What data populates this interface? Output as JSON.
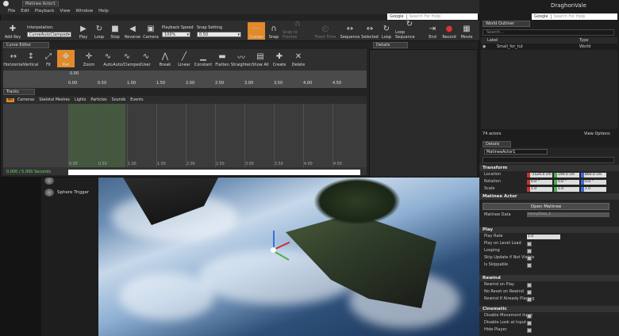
{
  "window": {
    "tab_title": "Matinee Actor1",
    "engine_title": "DraghonVale"
  },
  "menu": [
    "File",
    "Edit",
    "Playback",
    "View",
    "Window",
    "Help"
  ],
  "search": {
    "provider": "Google",
    "placeholder": "Search For Help"
  },
  "toolbar": {
    "add_key": "Add Key",
    "interpolation_label": "Interpolation:",
    "interpolation_value": "CurveAutoClamped",
    "play": "Play",
    "loop": "Loop",
    "stop": "Stop",
    "reverse": "Reverse",
    "camera": "Camera",
    "playback_speed_label": "Playback Speed",
    "playback_speed_value": "100%",
    "snap_setting_label": "Snap Setting",
    "snap_setting_value": "0.50",
    "curves": "Curves",
    "snap": "Snap",
    "snap_to_frames": "Snap to Frames",
    "fixed_time": "Fixed Time",
    "sequence": "Sequence",
    "selected": "Selected",
    "loop2": "Loop",
    "loop_sequence": "Loop Sequence",
    "end": "End",
    "record": "Record",
    "movie": "Movie"
  },
  "curve_editor": {
    "tab": "Curve Editor",
    "tools": [
      "Horizontal",
      "Vertical",
      "Fit",
      "Pan",
      "Zoom",
      "Auto",
      "Auto/Clamped",
      "User",
      "Break",
      "Linear",
      "Constant",
      "Flatten",
      "Straighten",
      "Show All",
      "Create",
      "Delete"
    ],
    "graph_top_label": "0.00",
    "ticks": [
      "0.00",
      "0.50",
      "1.00",
      "1.50",
      "2.00",
      "2.50",
      "3.00",
      "3.50",
      "4.00",
      "4.50"
    ]
  },
  "details_tab": "Details",
  "tracks": {
    "tab": "Tracks",
    "filters": [
      "All",
      "Cameras",
      "Skeletal Meshes",
      "Lights",
      "Particles",
      "Sounds",
      "Events"
    ],
    "ticks": [
      "0.00",
      "0.50",
      "1.00",
      "1.50",
      "2.00",
      "2.50",
      "3.00",
      "3.50",
      "4.00",
      "4.50"
    ],
    "time": "0.000 / 5.000 Seconds"
  },
  "place_items": [
    "Sphere Trigger"
  ],
  "world_outliner": {
    "tab": "World Outliner",
    "search_placeholder": "Search...",
    "col_label": "Label",
    "col_type": "Type",
    "row_label": "Small_for_tut",
    "row_type": "World",
    "actors": "74 actors",
    "view_options": "View Options"
  },
  "details": {
    "tab": "Details",
    "name": "MatineeActor1",
    "sections": {
      "transform": "Transform",
      "matinee_actor": "Matinee Actor",
      "play": "Play",
      "rewind": "Rewind",
      "cinematic": "Cinematic"
    },
    "location_label": "Location",
    "location": [
      "-1520.0 cm",
      "190.0 cm",
      "860.0 cm"
    ],
    "rotation_label": "Rotation",
    "rotation": [
      "0.0 °",
      "0.0 °",
      "0.0 °"
    ],
    "scale_label": "Scale",
    "scale": [
      "1.0",
      "1.0",
      "1.0"
    ],
    "open_matinee": "Open Matinee",
    "matinee_data_label": "Matinee Data",
    "matinee_data_value": "InterpData_1",
    "play_rate_label": "Play Rate",
    "play_rate_value": "1.0",
    "play_rows": [
      "Play on Level Load",
      "Looping",
      "Skip Update if Not Visible",
      "Is Skippable"
    ],
    "rewind_rows": [
      "Rewind on Play",
      "No Reset on Rewind",
      "Rewind If Already Playing"
    ],
    "cinematic_rows": [
      "Disable Movement Input",
      "Disable Look at Input",
      "Hide Player"
    ]
  },
  "colors": {
    "accent": "#e08a2b",
    "green": "#6cd86c",
    "x": "#c83232",
    "y": "#4caf50",
    "z": "#3a6fd8"
  }
}
